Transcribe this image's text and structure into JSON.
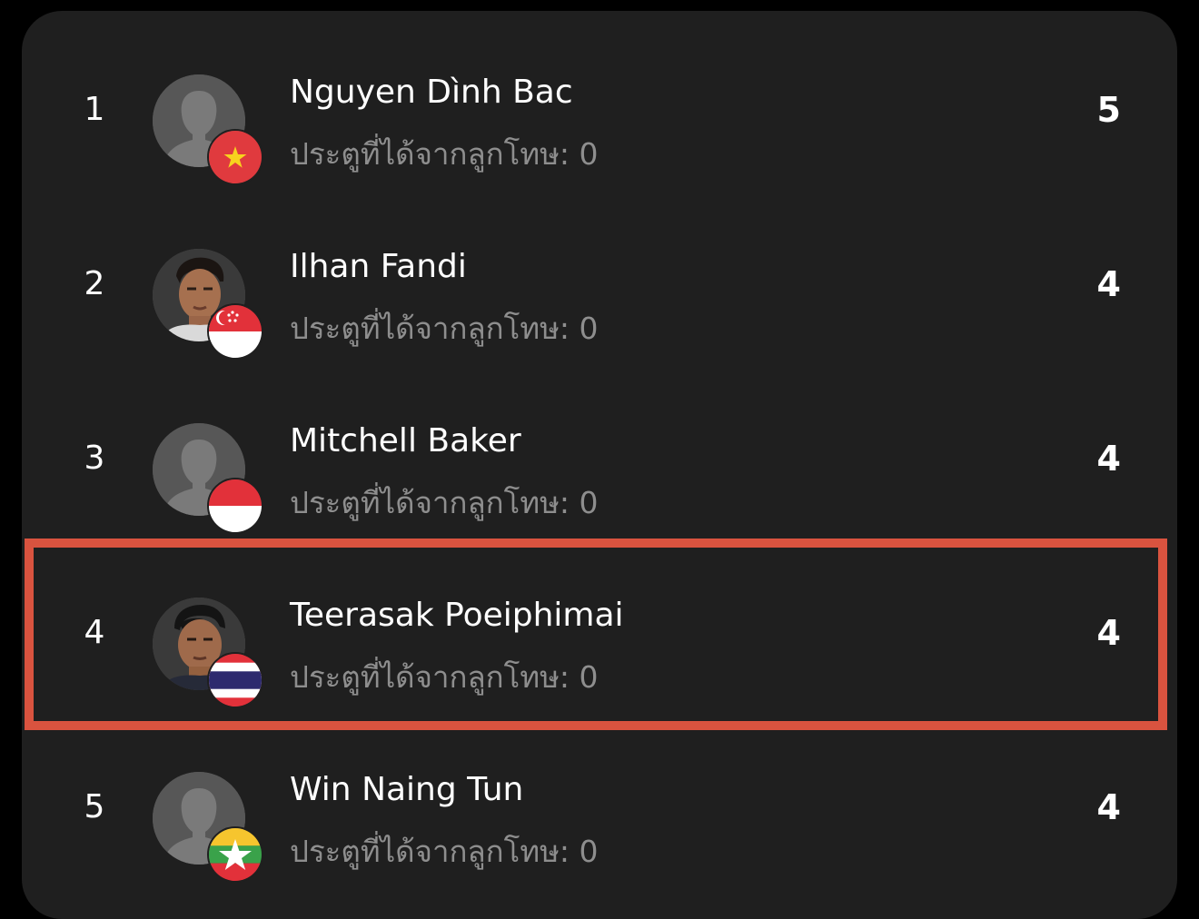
{
  "leaderboard": {
    "rows": [
      {
        "rank": "1",
        "name": "Nguyen Dình Bac",
        "subtitle": "ประตูที่ได้จากลูกโทษ: 0",
        "goals": "5",
        "avatar": "placeholder-silhouette-icon",
        "flag": "vietnam-flag-icon"
      },
      {
        "rank": "2",
        "name": "Ilhan Fandi",
        "subtitle": "ประตูที่ได้จากลูกโทษ: 0",
        "goals": "4",
        "avatar": "player-photo",
        "flag": "singapore-flag-icon"
      },
      {
        "rank": "3",
        "name": "Mitchell Baker",
        "subtitle": "ประตูที่ได้จากลูกโทษ: 0",
        "goals": "4",
        "avatar": "placeholder-silhouette-icon",
        "flag": "indonesia-flag-icon"
      },
      {
        "rank": "4",
        "name": "Teerasak Poeiphimai",
        "subtitle": "ประตูที่ได้จากลูกโทษ: 0",
        "goals": "4",
        "avatar": "player-photo",
        "flag": "thailand-flag-icon"
      },
      {
        "rank": "5",
        "name": "Win Naing Tun",
        "subtitle": "ประตูที่ได้จากลูกโทษ: 0",
        "goals": "4",
        "avatar": "placeholder-silhouette-icon",
        "flag": "myanmar-flag-icon"
      }
    ],
    "highlighted_rank": "4"
  },
  "colors": {
    "background": "#000000",
    "card": "#1f1f1f",
    "primary_text": "#ffffff",
    "secondary_text": "#8e8e8e",
    "highlight_border": "#d9533f"
  }
}
